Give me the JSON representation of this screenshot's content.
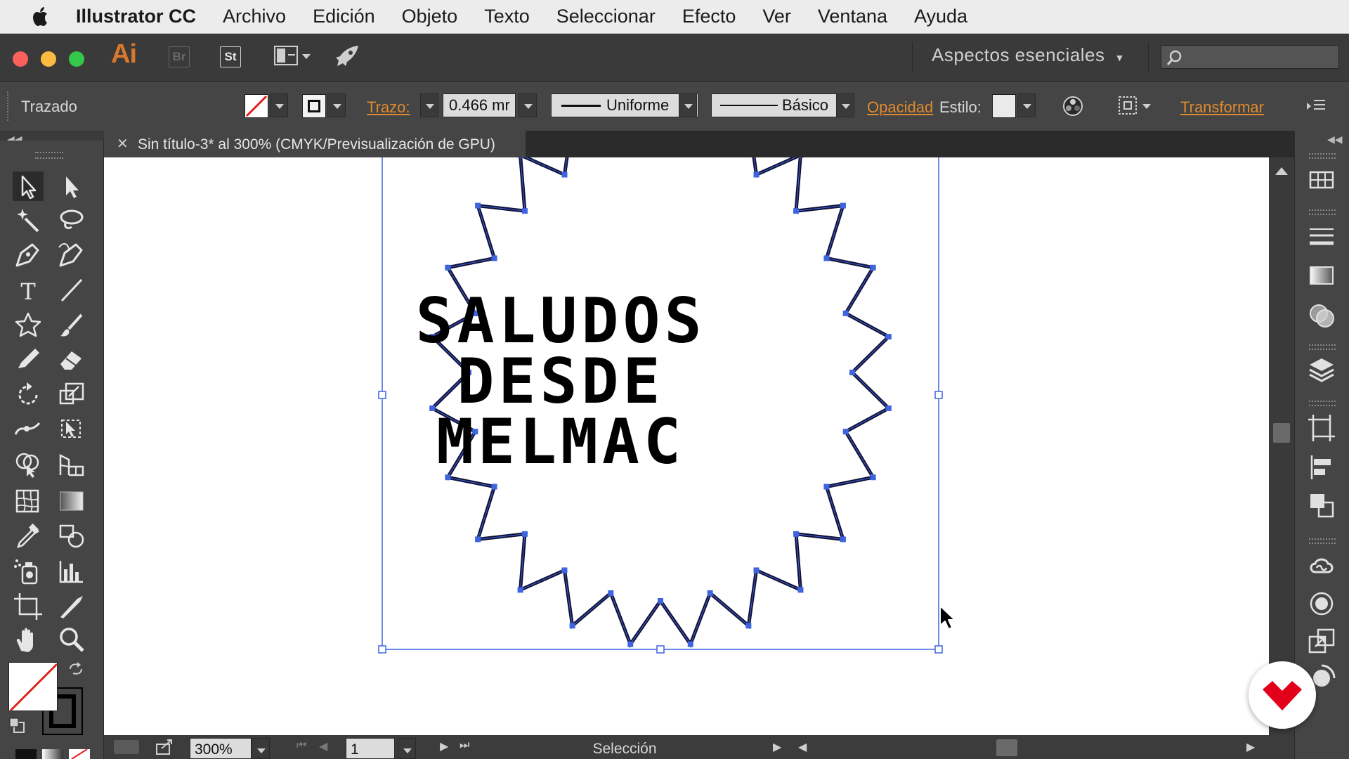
{
  "menubar": {
    "app_name": "Illustrator CC",
    "items": [
      "Archivo",
      "Edición",
      "Objeto",
      "Texto",
      "Seleccionar",
      "Efecto",
      "Ver",
      "Ventana",
      "Ayuda"
    ]
  },
  "appbar": {
    "logo": "Ai",
    "bridge_label": "Br",
    "stock_label": "St",
    "workspace": "Aspectos esenciales"
  },
  "controlbar": {
    "selection_type": "Trazado",
    "stroke_label": "Trazo:",
    "stroke_value": "0.466 mr",
    "profile": "Uniforme",
    "brush": "Básico",
    "opacity_label": "Opacidad",
    "style_label": "Estilo:",
    "transform_label": "Transformar"
  },
  "document": {
    "tab_title": "Sin título-3* al 300% (CMYK/Previsualización de GPU)"
  },
  "artwork": {
    "lines": [
      "SALUDOS",
      "DESDE",
      "MELMAC"
    ]
  },
  "statusbar": {
    "zoom": "300%",
    "artboard": "1",
    "tool_status": "Selección"
  },
  "colors": {
    "accent": "#e08a2e",
    "anchor": "#3e64e0",
    "path": "#111133"
  }
}
